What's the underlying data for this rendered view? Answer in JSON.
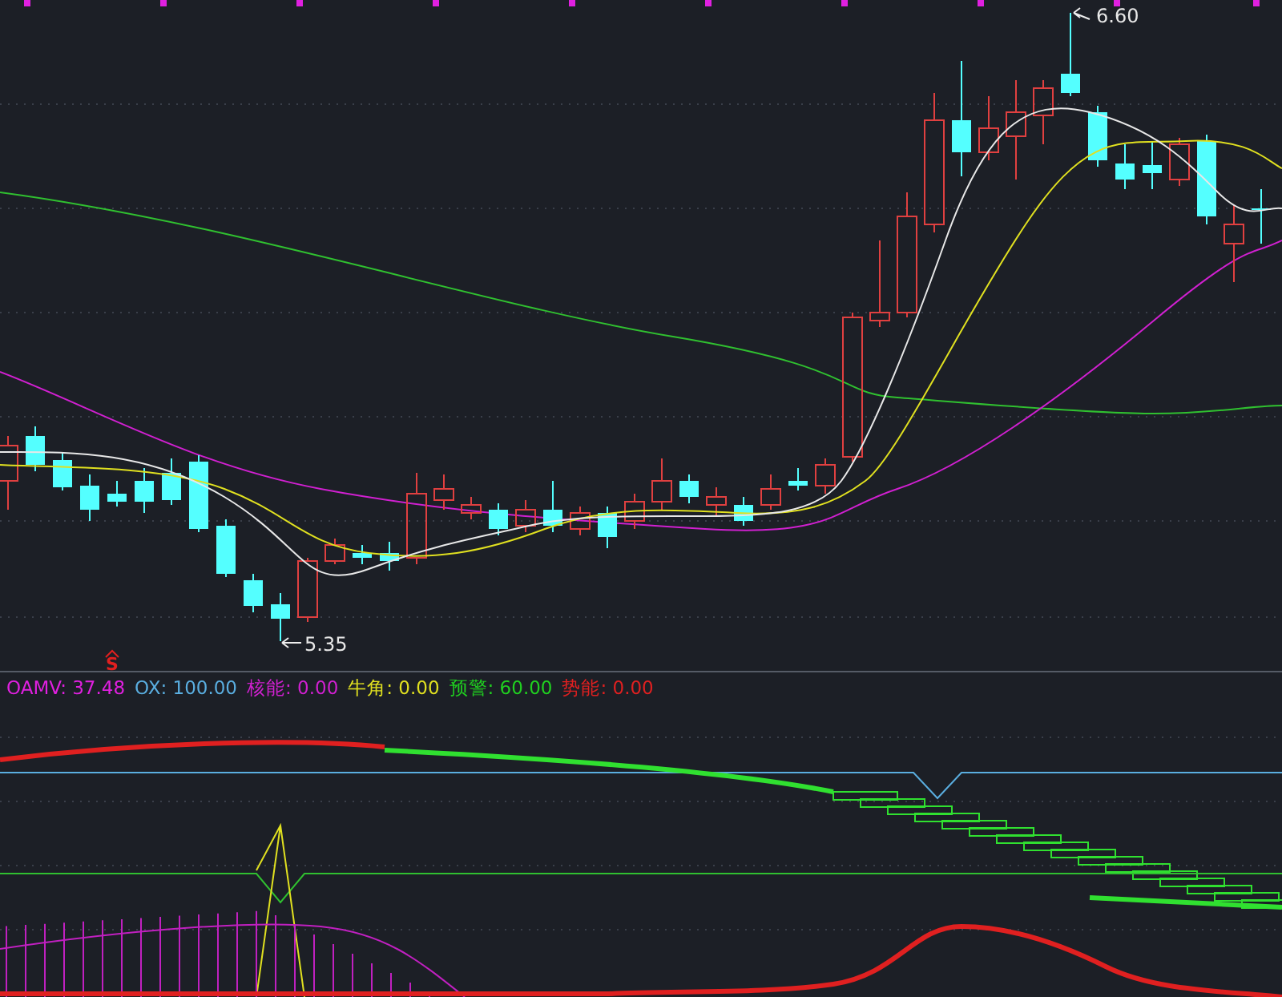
{
  "price_chart": {
    "high_label": "6.60",
    "low_label": "5.35",
    "signal": {
      "text": "S",
      "color": "#e02020"
    }
  },
  "indicator_legend": [
    {
      "label": "OAMV:",
      "value": "37.48",
      "color": "#e020e0"
    },
    {
      "label": "OX:",
      "value": "100.00",
      "color": "#5aaee0"
    },
    {
      "label": "核能:",
      "value": "0.00",
      "color": "#d020d0"
    },
    {
      "label": "牛角:",
      "value": "0.00",
      "color": "#e0e020"
    },
    {
      "label": "预警:",
      "value": "60.00",
      "color": "#20d020"
    },
    {
      "label": "势能:",
      "value": "0.00",
      "color": "#e02020"
    }
  ]
}
